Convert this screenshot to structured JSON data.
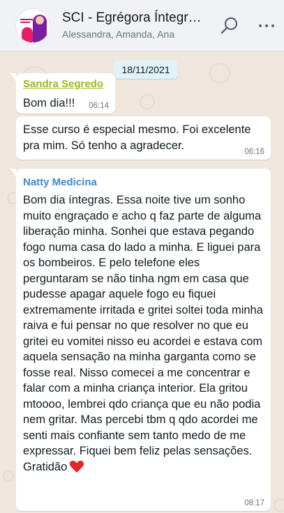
{
  "header": {
    "title": "SCI - Egrégora Íntegras",
    "subtitle": "Alessandra, Amanda, Ana"
  },
  "chat": {
    "date_chip": "18/11/2021",
    "messages": [
      {
        "sender": "Sandra Segredo",
        "text": "Bom dia!!!",
        "time": "06:14"
      },
      {
        "text": "Esse curso é especial mesmo. Foi excelente pra mim. Só tenho a agradecer.",
        "time": "06:16"
      },
      {
        "sender": "Natty Medicina",
        "text": "Bom dia íntegras. Essa noite tive um sonho muito engraçado e acho q faz parte de alguma liberação minha. Sonhei que estava pegando fogo numa casa do lado a minha. E liguei para os bombeiros. E pelo telefone eles perguntaram se não tinha ngm em casa que pudesse apagar aquele fogo eu fiquei extremamente irritada e gritei soltei toda minha raiva e fui pensar no que resolver no que eu gritei eu vomitei nisso eu acordei e estava com aquela sensação na minha garganta como se fosse real. Nisso comecei a me concentrar e falar com a minha criança interior. Ela gritou mtoooo, lembrei qdo criança que eu não podia nem gritar. Mas percebi tbm q qdo acordei me senti mais confiante sem tanto medo de me expressar. Fiquei bem feliz pelas sensações. Gratidão",
        "time": "08:17"
      }
    ]
  },
  "colors": {
    "chat_background": "#efe7dd",
    "header_background": "#f0f2f5",
    "sender_1": "#9eb81e",
    "sender_3": "#3d8ad4",
    "date_chip_background": "#e1f2fa",
    "heart": "#e0282e"
  },
  "icons": [
    "search-icon",
    "menu-icon",
    "heart-icon"
  ]
}
